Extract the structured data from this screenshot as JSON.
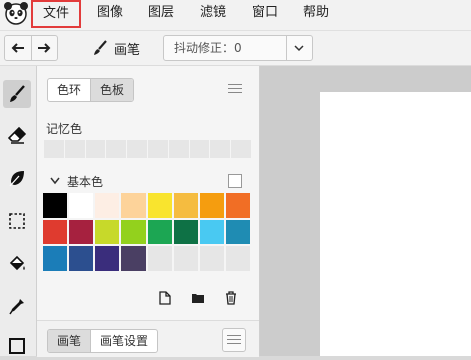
{
  "menu": {
    "items": [
      "文件",
      "图像",
      "图层",
      "滤镜",
      "窗口",
      "帮助"
    ],
    "active_index": 0
  },
  "toolbar": {
    "tool_name": "画笔",
    "stabilizer_text": "抖动修正：0"
  },
  "tools": [
    "brush-icon",
    "eraser-icon",
    "leaf-icon",
    "marquee-select-icon",
    "paint-bucket-icon",
    "eyedropper-icon",
    "square-icon"
  ],
  "color_panel": {
    "tabs": [
      "色环",
      "色板"
    ],
    "active_tab": 1,
    "memory_title": "记忆色",
    "memory_slots": 10,
    "basic_title": "基本色",
    "swatches": [
      "#000000",
      "#ffffff",
      "#fdeee4",
      "#fdd39a",
      "#f9e42e",
      "#f5bc40",
      "#f59d0f",
      "#f16e25",
      "#df3b2f",
      "#a6213f",
      "#c7d92a",
      "#93d11d",
      "#1ca653",
      "#0e7145",
      "#49c9f2",
      "#1f8cb3",
      "#1b7db8",
      "#2c4f8f",
      "#3a2d7c",
      "#4a3f63",
      "#e6e6e6",
      "#e6e6e6",
      "#e6e6e6",
      "#e6e6e6"
    ]
  },
  "brush_panel": {
    "tabs": [
      "画笔",
      "画笔设置"
    ],
    "active_tab": 0
  },
  "colors": {
    "menu_highlight": "#e23b3b",
    "canvas_bg": "#cccccc"
  }
}
